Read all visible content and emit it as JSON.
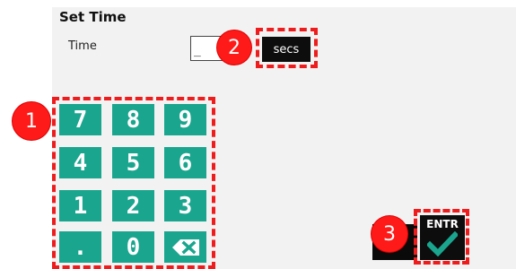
{
  "dialog": {
    "title": "Set Time",
    "time_label": "Time",
    "time_value": "_",
    "unit_label": "secs"
  },
  "keypad": {
    "keys": [
      "7",
      "8",
      "9",
      "4",
      "5",
      "6",
      "1",
      "2",
      "3",
      ".",
      "0",
      "backspace-icon"
    ]
  },
  "enter": {
    "label": "ENTR",
    "icon": "checkmark-icon"
  },
  "annotations": {
    "markers": [
      "1",
      "2",
      "3"
    ],
    "color": "#ee1c1c"
  },
  "colors": {
    "key_bg": "#1aa58e",
    "panel_bg": "#f2f2f2",
    "button_dark": "#0d0d0d",
    "check_green": "#1aa58e"
  }
}
